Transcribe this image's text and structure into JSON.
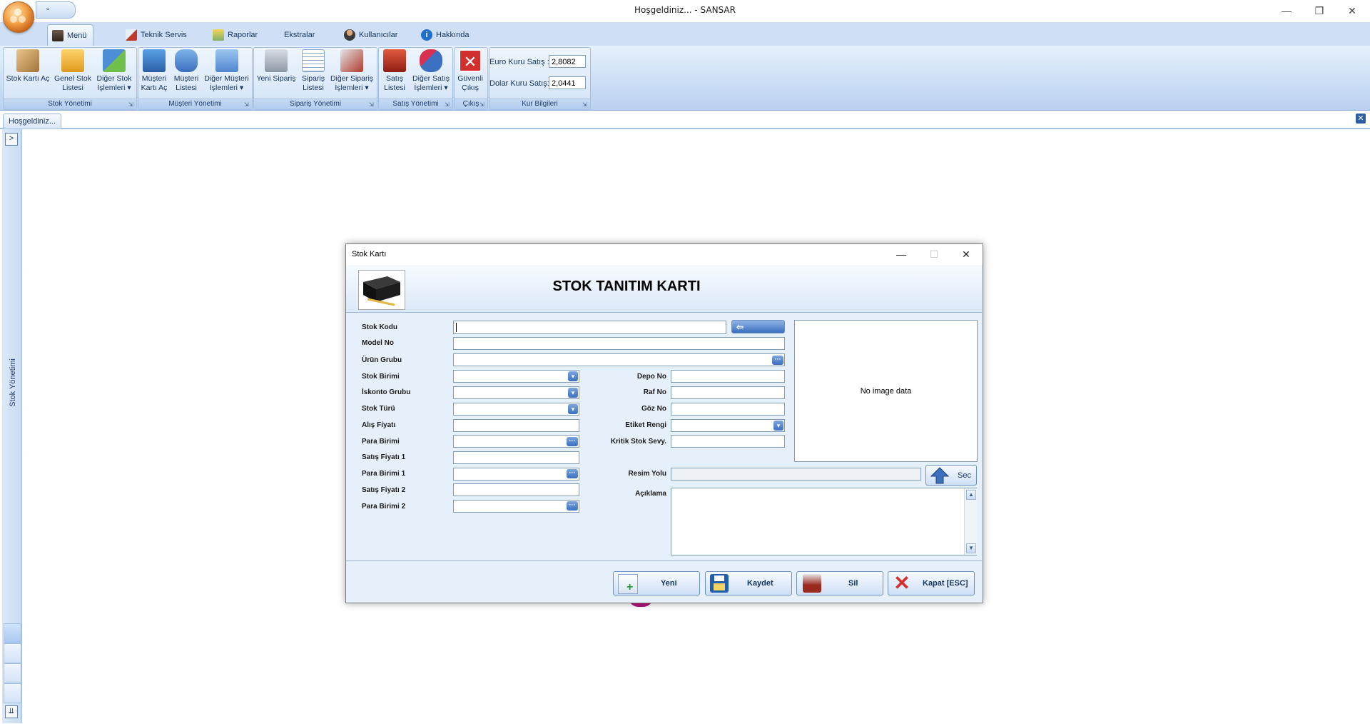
{
  "window": {
    "title": "Hoşgeldiniz... - SANSAR",
    "qat_label": "⌄",
    "minimize": "—",
    "restore": "❐",
    "close": "✕"
  },
  "ribbon": {
    "tabs": [
      {
        "label": "Menü",
        "icon": "book-icon",
        "active": true
      },
      {
        "label": "Teknik Servis",
        "icon": "service-icon",
        "active": false
      },
      {
        "label": "Raporlar",
        "icon": "reports-icon",
        "active": false
      },
      {
        "label": "Ekstralar",
        "icon": "",
        "active": false
      },
      {
        "label": "Kullanıcılar",
        "icon": "user-icon",
        "active": false
      },
      {
        "label": "Hakkında",
        "icon": "info-icon",
        "active": false
      }
    ],
    "groups": {
      "stok": {
        "label": "Stok Yönetimi",
        "buttons": [
          {
            "line1": "Stok Kartı Aç",
            "line2": ""
          },
          {
            "line1": "Genel Stok",
            "line2": "Listesi"
          },
          {
            "line1": "Diğer Stok",
            "line2": "İşlemleri ▾"
          }
        ]
      },
      "musteri": {
        "label": "Müşteri Yönetimi",
        "buttons": [
          {
            "line1": "Müşteri",
            "line2": "Kartı Aç"
          },
          {
            "line1": "Müşteri",
            "line2": "Listesi"
          },
          {
            "line1": "Diğer Müşteri",
            "line2": "İşlemleri ▾"
          }
        ]
      },
      "siparis": {
        "label": "Sipariş Yönetimi",
        "buttons": [
          {
            "line1": "Yeni Sipariş",
            "line2": ""
          },
          {
            "line1": "Sipariş",
            "line2": "Listesi"
          },
          {
            "line1": "Diğer Sipariş",
            "line2": "İşlemleri ▾"
          }
        ]
      },
      "satis": {
        "label": "Satış Yönetimi",
        "buttons": [
          {
            "line1": "Satış",
            "line2": "Listesi"
          },
          {
            "line1": "Diğer Satış",
            "line2": "İşlemleri ▾"
          }
        ]
      },
      "cikis": {
        "label": "Çıkış",
        "buttons": [
          {
            "line1": "Güvenli",
            "line2": "Çıkış"
          }
        ]
      },
      "kur": {
        "label": "Kur Bilgileri",
        "euro_label": "Euro Kuru Satış :",
        "euro_value": "2,8082",
        "dolar_label": "Dolar Kuru Satış:",
        "dolar_value": "2,0441"
      },
      "launcher": "⇲"
    }
  },
  "document_tab": {
    "label": "Hoşgeldiniz...",
    "close": "✕"
  },
  "left_panel": {
    "title": "Stok Yönetimi",
    "expand": ">",
    "bottom": "⇊"
  },
  "dialog": {
    "title": "Stok Kartı",
    "minimize": "—",
    "maximize": "☐",
    "close": "✕",
    "header_title": "STOK TANITIM KARTI",
    "fields_left": {
      "stok_kodu": "Stok Kodu",
      "model_no": "Model No",
      "urun_grubu": "Ürün Grubu",
      "stok_birimi": "Stok Birimi",
      "iskonto_grubu": "İskonto Grubu",
      "stok_turu": "Stok Türü",
      "alis_fiyati": "Alış Fiyatı",
      "para_birimi": "Para Birimi",
      "satis_fiyati_1": "Satış Fiyatı 1",
      "para_birimi_1": "Para Birimi 1",
      "satis_fiyati_2": "Satış Fiyatı 2",
      "para_birimi_2": "Para Birimi 2"
    },
    "fields_right": {
      "depo_no": "Depo No",
      "raf_no": "Raf No",
      "goz_no": "Göz No",
      "etiket_rengi": "Etiket Rengi",
      "kritik_stok": "Kritik Stok Sevy.",
      "resim_yolu": "Resim Yolu",
      "aciklama": "Açıklama"
    },
    "image_placeholder": "No image data",
    "sec_button": "Sec",
    "buttons": {
      "yeni": "Yeni",
      "kaydet": "Kaydet",
      "sil": "Sil",
      "kapat": "Kapat [ESC]"
    }
  },
  "colors": {
    "ribbon_bg": "#c6daf3",
    "dialog_bg": "#e6f0fb",
    "accent_blue": "#3b6fbf",
    "close_red": "#d32f2f"
  }
}
